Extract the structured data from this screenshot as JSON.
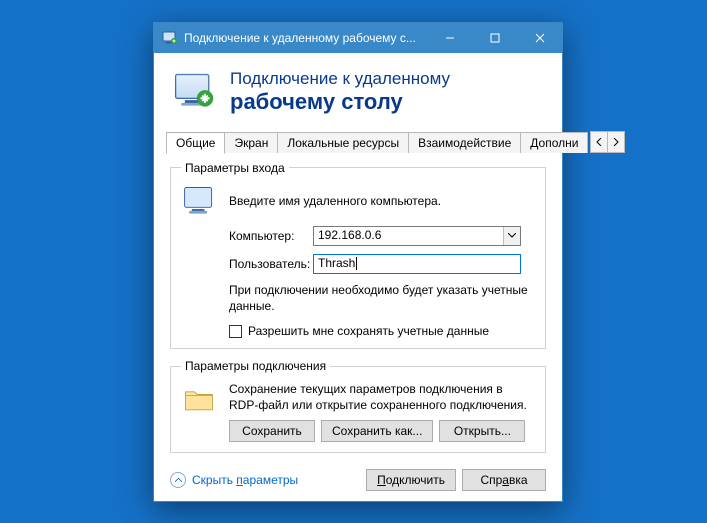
{
  "window": {
    "title": "Подключение к удаленному рабочему с..."
  },
  "hero": {
    "line1": "Подключение к удаленному",
    "line2": "рабочему столу"
  },
  "tabs": {
    "t0": "Общие",
    "t1": "Экран",
    "t2": "Локальные ресурсы",
    "t3": "Взаимодействие",
    "t4": "Дополни"
  },
  "login": {
    "legend": "Параметры входа",
    "intro": "Введите имя удаленного компьютера.",
    "computer_label": "Компьютер:",
    "computer_value": "192.168.0.6",
    "user_label": "Пользователь:",
    "user_value": "Thrash",
    "note": "При подключении необходимо будет указать учетные данные.",
    "remember": "Разрешить мне сохранять учетные данные"
  },
  "conn": {
    "legend": "Параметры подключения",
    "desc": "Сохранение текущих параметров подключения в RDP-файл или открытие сохраненного подключения.",
    "save": "Сохранить",
    "save_as": "Сохранить как...",
    "open": "Открыть..."
  },
  "footer": {
    "hide_pre": "Скрыть ",
    "hide_u": "п",
    "hide_post": "араметры",
    "connect_u": "П",
    "connect_post": "одключить",
    "help_pre": "Спр",
    "help_u": "а",
    "help_post": "вка"
  }
}
